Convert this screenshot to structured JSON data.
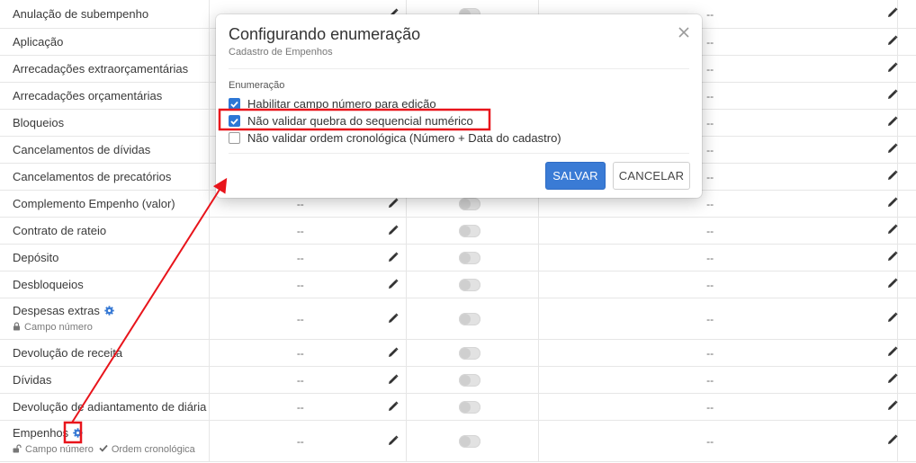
{
  "table": {
    "rows": [
      {
        "name": "Anulação de subempenho",
        "num": "",
        "val": "--"
      },
      {
        "name": "Aplicação",
        "num": "",
        "val": "--"
      },
      {
        "name": "Arrecadações extraorçamentárias",
        "num": "",
        "val": "--"
      },
      {
        "name": "Arrecadações orçamentárias",
        "num": "",
        "val": "--"
      },
      {
        "name": "Bloqueios",
        "num": "",
        "val": "--"
      },
      {
        "name": "Cancelamentos de dívidas",
        "num": "",
        "val": "--"
      },
      {
        "name": "Cancelamentos de precatórios",
        "num": "",
        "val": "--"
      },
      {
        "name": "Complemento Empenho (valor)",
        "num": "--",
        "val": "--"
      },
      {
        "name": "Contrato de rateio",
        "num": "--",
        "val": "--"
      },
      {
        "name": "Depósito",
        "num": "--",
        "val": "--"
      },
      {
        "name": "Desbloqueios",
        "num": "--",
        "val": "--"
      },
      {
        "name": "Despesas extras",
        "num": "--",
        "val": "--",
        "sub1": "Campo número"
      },
      {
        "name": "Devolução de receita",
        "num": "--",
        "val": "--"
      },
      {
        "name": "Dívidas",
        "num": "--",
        "val": "--"
      },
      {
        "name": "Devolução de adiantamento de diária",
        "num": "--",
        "val": "--"
      },
      {
        "name": "Empenhos",
        "num": "--",
        "val": "--",
        "sub1": "Campo número",
        "sub2": "Ordem cronológica"
      }
    ]
  },
  "modal": {
    "title": "Configurando enumeração",
    "subtitle": "Cadastro de Empenhos",
    "section_label": "Enumeração",
    "options": [
      {
        "label": "Habilitar campo número para edição",
        "checked": true
      },
      {
        "label": "Não validar quebra do sequencial numérico",
        "checked": true
      },
      {
        "label": "Não validar ordem cronológica (Número + Data do cadastro)",
        "checked": false
      }
    ],
    "save_label": "SALVAR",
    "cancel_label": "CANCELAR"
  },
  "colors": {
    "accent": "#2d77d5",
    "annotation": "#e8141b",
    "gear": "#3a7bd5"
  }
}
